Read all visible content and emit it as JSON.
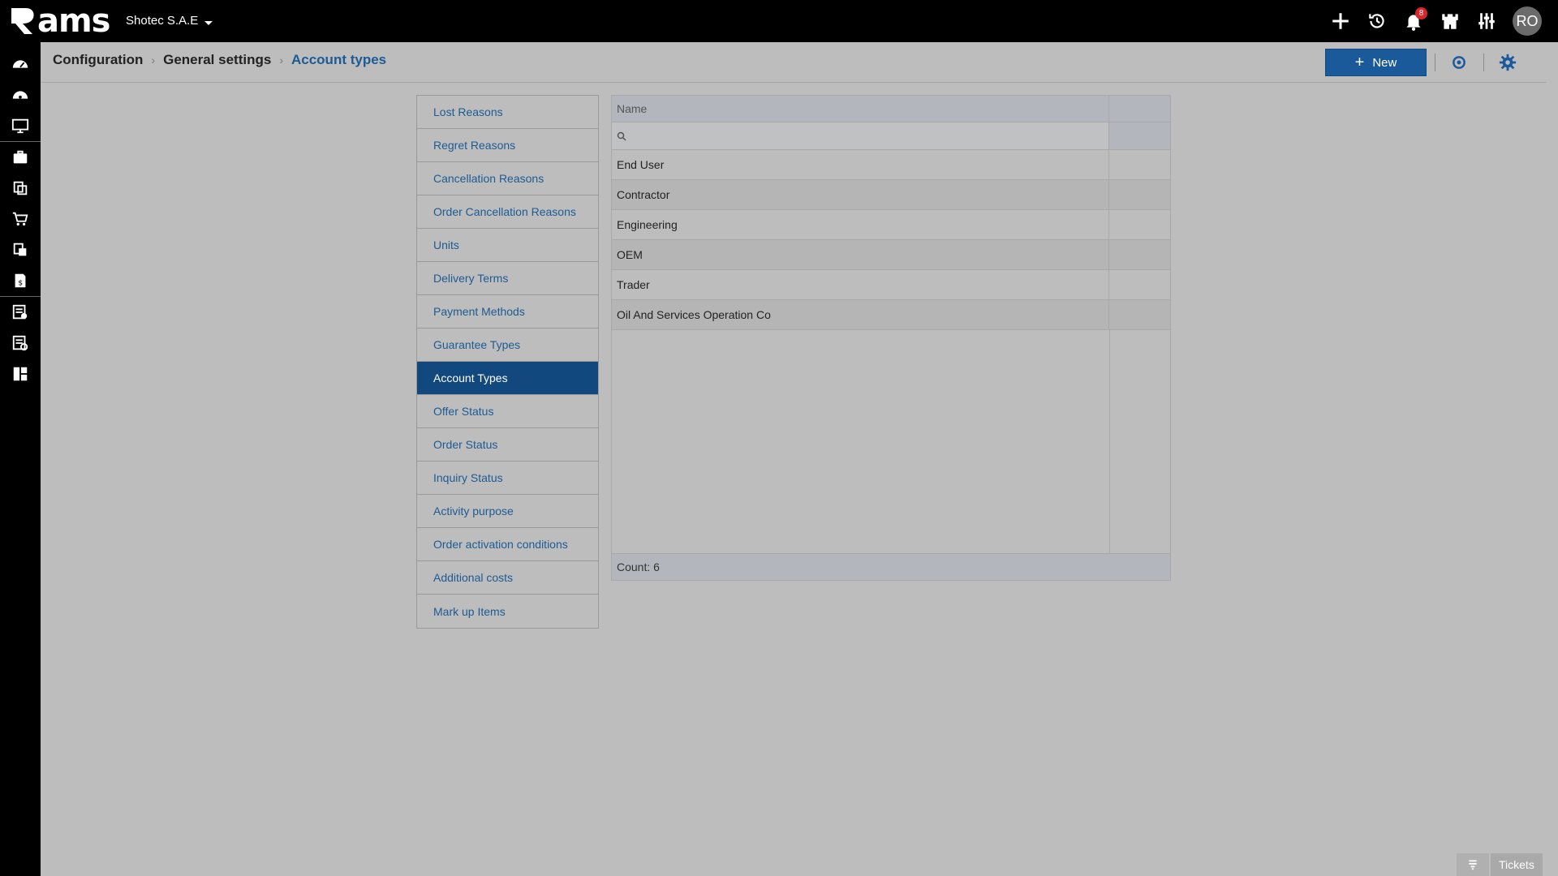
{
  "app": {
    "logo_text": "ams",
    "company": "Shotec S.A.E"
  },
  "topbar": {
    "icons": [
      "plus-icon",
      "history-icon",
      "bell-icon",
      "castle-icon",
      "sliders-icon"
    ],
    "notification_count": "8",
    "avatar_initials": "RO"
  },
  "sidenav": {
    "items": [
      "dashboard-icon",
      "speedometer-icon",
      "monitor-icon",
      "briefcase-icon",
      "documents-icon",
      "cart-icon",
      "catalog-icon",
      "invoice-icon",
      "checklist-icon",
      "settings-list-icon",
      "grid-icon"
    ]
  },
  "breadcrumb": {
    "items": [
      "Configuration",
      "General settings",
      "Account types"
    ]
  },
  "header": {
    "new_label": "New"
  },
  "settings_list": {
    "items": [
      "Lost Reasons",
      "Regret Reasons",
      "Cancellation Reasons",
      "Order Cancellation Reasons",
      "Units",
      "Delivery Terms",
      "Payment Methods",
      "Guarantee Types",
      "Account Types",
      "Offer Status",
      "Order Status",
      "Inquiry Status",
      "Activity purpose",
      "Order activation conditions",
      "Additional costs",
      "Mark up Items"
    ],
    "active": "Account Types"
  },
  "grid": {
    "column_name": "Name",
    "filter_placeholder": "",
    "rows": [
      "End User",
      "Contractor",
      "Engineering",
      "OEM",
      "Trader",
      "Oil And Services Operation Co"
    ],
    "count_label": "Count: 6"
  },
  "footer": {
    "tickets_label": "Tickets"
  },
  "colors": {
    "primary": "#1a5a9a",
    "active_item": "#11487e",
    "link": "#1c5b94",
    "badge": "#d9262a"
  }
}
